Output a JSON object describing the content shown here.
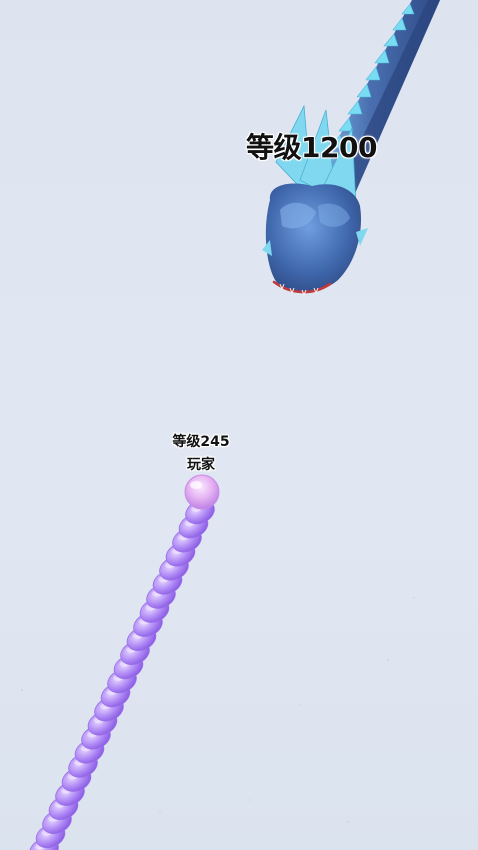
{
  "game": {
    "enemy_snake": {
      "level_text": "等级1200",
      "colors": {
        "body": "#4a6fb0",
        "body_dark": "#2d4a86",
        "spikes": "#6fd3ec",
        "mouth": "#c0393b"
      }
    },
    "player_snake": {
      "level_text": "等级245",
      "name": "玩家",
      "colors": {
        "body": "#b38cf5",
        "body_dark": "#8b5de8",
        "head": "#e9b8f0"
      }
    },
    "ground_color": "#dfe6f1"
  }
}
